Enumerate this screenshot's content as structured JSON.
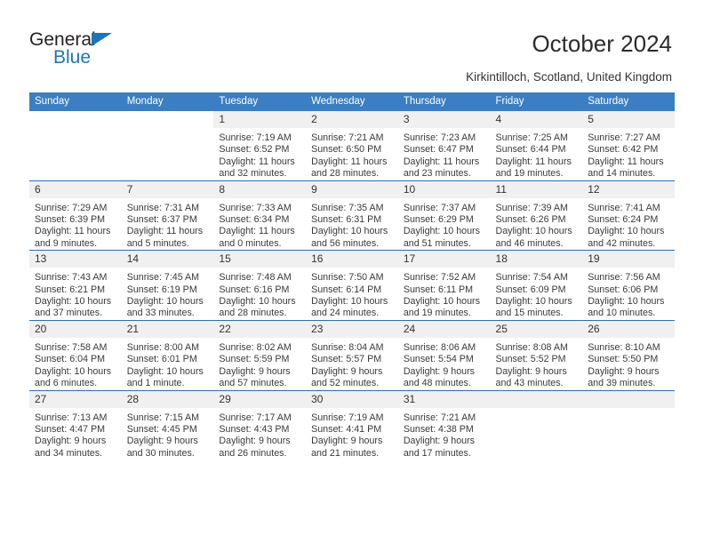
{
  "brand": {
    "name_top": "General",
    "name_bottom": "Blue",
    "triangle_color": "#1b75bb"
  },
  "header": {
    "title": "October 2024",
    "subtitle": "Kirkintilloch, Scotland, United Kingdom"
  },
  "theme": {
    "header_blue": "#3b7ec1",
    "row_divider": "#2f6fae",
    "daynum_band": "#f0f0f0",
    "text": "#3a3a3a"
  },
  "weekdays": [
    "Sunday",
    "Monday",
    "Tuesday",
    "Wednesday",
    "Thursday",
    "Friday",
    "Saturday"
  ],
  "weeks": [
    [
      {
        "day": "",
        "blank": true
      },
      {
        "day": "",
        "blank": true
      },
      {
        "day": "1",
        "sunrise": "Sunrise: 7:19 AM",
        "sunset": "Sunset: 6:52 PM",
        "daylight1": "Daylight: 11 hours",
        "daylight2": "and 32 minutes."
      },
      {
        "day": "2",
        "sunrise": "Sunrise: 7:21 AM",
        "sunset": "Sunset: 6:50 PM",
        "daylight1": "Daylight: 11 hours",
        "daylight2": "and 28 minutes."
      },
      {
        "day": "3",
        "sunrise": "Sunrise: 7:23 AM",
        "sunset": "Sunset: 6:47 PM",
        "daylight1": "Daylight: 11 hours",
        "daylight2": "and 23 minutes."
      },
      {
        "day": "4",
        "sunrise": "Sunrise: 7:25 AM",
        "sunset": "Sunset: 6:44 PM",
        "daylight1": "Daylight: 11 hours",
        "daylight2": "and 19 minutes."
      },
      {
        "day": "5",
        "sunrise": "Sunrise: 7:27 AM",
        "sunset": "Sunset: 6:42 PM",
        "daylight1": "Daylight: 11 hours",
        "daylight2": "and 14 minutes."
      }
    ],
    [
      {
        "day": "6",
        "sunrise": "Sunrise: 7:29 AM",
        "sunset": "Sunset: 6:39 PM",
        "daylight1": "Daylight: 11 hours",
        "daylight2": "and 9 minutes."
      },
      {
        "day": "7",
        "sunrise": "Sunrise: 7:31 AM",
        "sunset": "Sunset: 6:37 PM",
        "daylight1": "Daylight: 11 hours",
        "daylight2": "and 5 minutes."
      },
      {
        "day": "8",
        "sunrise": "Sunrise: 7:33 AM",
        "sunset": "Sunset: 6:34 PM",
        "daylight1": "Daylight: 11 hours",
        "daylight2": "and 0 minutes."
      },
      {
        "day": "9",
        "sunrise": "Sunrise: 7:35 AM",
        "sunset": "Sunset: 6:31 PM",
        "daylight1": "Daylight: 10 hours",
        "daylight2": "and 56 minutes."
      },
      {
        "day": "10",
        "sunrise": "Sunrise: 7:37 AM",
        "sunset": "Sunset: 6:29 PM",
        "daylight1": "Daylight: 10 hours",
        "daylight2": "and 51 minutes."
      },
      {
        "day": "11",
        "sunrise": "Sunrise: 7:39 AM",
        "sunset": "Sunset: 6:26 PM",
        "daylight1": "Daylight: 10 hours",
        "daylight2": "and 46 minutes."
      },
      {
        "day": "12",
        "sunrise": "Sunrise: 7:41 AM",
        "sunset": "Sunset: 6:24 PM",
        "daylight1": "Daylight: 10 hours",
        "daylight2": "and 42 minutes."
      }
    ],
    [
      {
        "day": "13",
        "sunrise": "Sunrise: 7:43 AM",
        "sunset": "Sunset: 6:21 PM",
        "daylight1": "Daylight: 10 hours",
        "daylight2": "and 37 minutes."
      },
      {
        "day": "14",
        "sunrise": "Sunrise: 7:45 AM",
        "sunset": "Sunset: 6:19 PM",
        "daylight1": "Daylight: 10 hours",
        "daylight2": "and 33 minutes."
      },
      {
        "day": "15",
        "sunrise": "Sunrise: 7:48 AM",
        "sunset": "Sunset: 6:16 PM",
        "daylight1": "Daylight: 10 hours",
        "daylight2": "and 28 minutes."
      },
      {
        "day": "16",
        "sunrise": "Sunrise: 7:50 AM",
        "sunset": "Sunset: 6:14 PM",
        "daylight1": "Daylight: 10 hours",
        "daylight2": "and 24 minutes."
      },
      {
        "day": "17",
        "sunrise": "Sunrise: 7:52 AM",
        "sunset": "Sunset: 6:11 PM",
        "daylight1": "Daylight: 10 hours",
        "daylight2": "and 19 minutes."
      },
      {
        "day": "18",
        "sunrise": "Sunrise: 7:54 AM",
        "sunset": "Sunset: 6:09 PM",
        "daylight1": "Daylight: 10 hours",
        "daylight2": "and 15 minutes."
      },
      {
        "day": "19",
        "sunrise": "Sunrise: 7:56 AM",
        "sunset": "Sunset: 6:06 PM",
        "daylight1": "Daylight: 10 hours",
        "daylight2": "and 10 minutes."
      }
    ],
    [
      {
        "day": "20",
        "sunrise": "Sunrise: 7:58 AM",
        "sunset": "Sunset: 6:04 PM",
        "daylight1": "Daylight: 10 hours",
        "daylight2": "and 6 minutes."
      },
      {
        "day": "21",
        "sunrise": "Sunrise: 8:00 AM",
        "sunset": "Sunset: 6:01 PM",
        "daylight1": "Daylight: 10 hours",
        "daylight2": "and 1 minute."
      },
      {
        "day": "22",
        "sunrise": "Sunrise: 8:02 AM",
        "sunset": "Sunset: 5:59 PM",
        "daylight1": "Daylight: 9 hours",
        "daylight2": "and 57 minutes."
      },
      {
        "day": "23",
        "sunrise": "Sunrise: 8:04 AM",
        "sunset": "Sunset: 5:57 PM",
        "daylight1": "Daylight: 9 hours",
        "daylight2": "and 52 minutes."
      },
      {
        "day": "24",
        "sunrise": "Sunrise: 8:06 AM",
        "sunset": "Sunset: 5:54 PM",
        "daylight1": "Daylight: 9 hours",
        "daylight2": "and 48 minutes."
      },
      {
        "day": "25",
        "sunrise": "Sunrise: 8:08 AM",
        "sunset": "Sunset: 5:52 PM",
        "daylight1": "Daylight: 9 hours",
        "daylight2": "and 43 minutes."
      },
      {
        "day": "26",
        "sunrise": "Sunrise: 8:10 AM",
        "sunset": "Sunset: 5:50 PM",
        "daylight1": "Daylight: 9 hours",
        "daylight2": "and 39 minutes."
      }
    ],
    [
      {
        "day": "27",
        "sunrise": "Sunrise: 7:13 AM",
        "sunset": "Sunset: 4:47 PM",
        "daylight1": "Daylight: 9 hours",
        "daylight2": "and 34 minutes."
      },
      {
        "day": "28",
        "sunrise": "Sunrise: 7:15 AM",
        "sunset": "Sunset: 4:45 PM",
        "daylight1": "Daylight: 9 hours",
        "daylight2": "and 30 minutes."
      },
      {
        "day": "29",
        "sunrise": "Sunrise: 7:17 AM",
        "sunset": "Sunset: 4:43 PM",
        "daylight1": "Daylight: 9 hours",
        "daylight2": "and 26 minutes."
      },
      {
        "day": "30",
        "sunrise": "Sunrise: 7:19 AM",
        "sunset": "Sunset: 4:41 PM",
        "daylight1": "Daylight: 9 hours",
        "daylight2": "and 21 minutes."
      },
      {
        "day": "31",
        "sunrise": "Sunrise: 7:21 AM",
        "sunset": "Sunset: 4:38 PM",
        "daylight1": "Daylight: 9 hours",
        "daylight2": "and 17 minutes."
      },
      {
        "day": "",
        "blank": true
      },
      {
        "day": "",
        "blank": true
      }
    ]
  ]
}
